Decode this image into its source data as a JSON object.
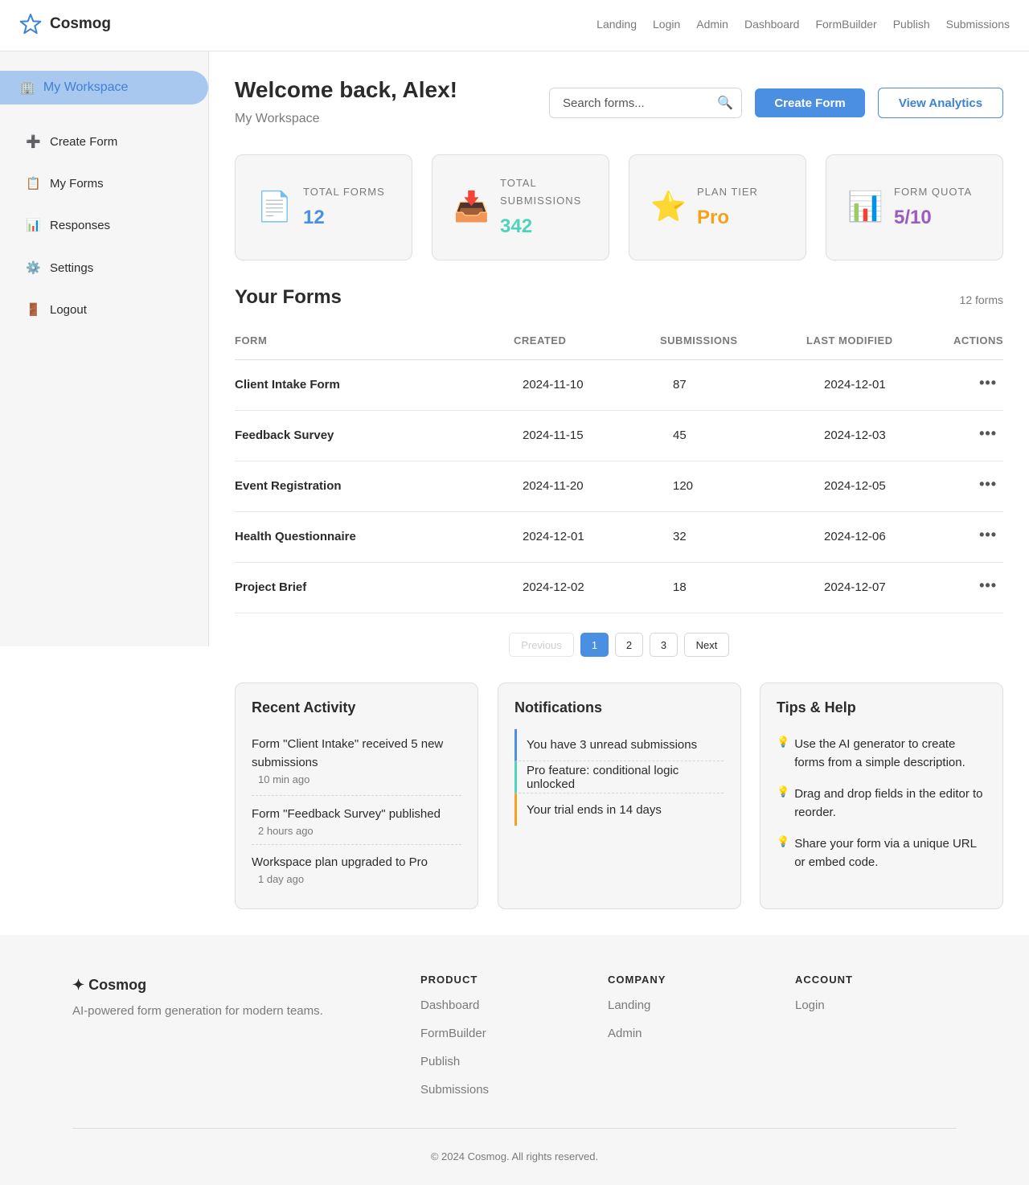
{
  "app": {
    "name": "Cosmog"
  },
  "nav": [
    "Landing",
    "Login",
    "Admin",
    "Dashboard",
    "FormBuilder",
    "Publish",
    "Submissions"
  ],
  "sidebar": {
    "workspace": {
      "icon": "🏢",
      "label": "My Workspace"
    },
    "items": [
      {
        "icon": "➕",
        "label": "Create Form"
      },
      {
        "icon": "📋",
        "label": "My Forms"
      },
      {
        "icon": "📊",
        "label": "Responses"
      },
      {
        "icon": "⚙️",
        "label": "Settings"
      },
      {
        "icon": "🚪",
        "label": "Logout"
      }
    ]
  },
  "header": {
    "title": "Welcome back, Alex!",
    "subtitle": "My Workspace",
    "search_placeholder": "Search forms...",
    "create_label": "Create Form",
    "analytics_label": "View Analytics"
  },
  "stats": [
    {
      "icon": "📄",
      "label": "Total Forms",
      "value": "12",
      "color": "#4a8fe2"
    },
    {
      "icon": "📥",
      "label": "Total Submissions",
      "value": "342",
      "color": "#4fd3bd"
    },
    {
      "icon": "⭐",
      "label": "Plan Tier",
      "value": "Pro",
      "color": "#f4a11c"
    },
    {
      "icon": "📊",
      "label": "Form Quota",
      "value": "5/10",
      "color": "#9b5bc0"
    }
  ],
  "forms": {
    "title": "Your Forms",
    "count": "12 forms",
    "columns": [
      "FORM",
      "CREATED",
      "SUBMISSIONS",
      "LAST MODIFIED",
      "ACTIONS"
    ],
    "rows": [
      {
        "name": "Client Intake Form",
        "created": "2024-11-10",
        "submissions": "87",
        "modified": "2024-12-01"
      },
      {
        "name": "Feedback Survey",
        "created": "2024-11-15",
        "submissions": "45",
        "modified": "2024-12-03"
      },
      {
        "name": "Event Registration",
        "created": "2024-11-20",
        "submissions": "120",
        "modified": "2024-12-05"
      },
      {
        "name": "Health Questionnaire",
        "created": "2024-12-01",
        "submissions": "32",
        "modified": "2024-12-06"
      },
      {
        "name": "Project Brief",
        "created": "2024-12-02",
        "submissions": "18",
        "modified": "2024-12-07"
      }
    ],
    "actions_glyph": "•••"
  },
  "pagination": {
    "previous": "Previous",
    "pages": [
      "1",
      "2",
      "3"
    ],
    "next": "Next",
    "current": "1"
  },
  "activity": {
    "title": "Recent Activity",
    "items": [
      {
        "text": "Form \"Client Intake\" received 5 new submissions",
        "time": "10 min ago"
      },
      {
        "text": "Form \"Feedback Survey\" published",
        "time": "2 hours ago"
      },
      {
        "text": "Workspace plan upgraded to Pro",
        "time": "1 day ago"
      }
    ]
  },
  "notifications": {
    "title": "Notifications",
    "items": [
      {
        "text": "You have 3 unread submissions",
        "color": "#4a8fe2"
      },
      {
        "text": "Pro feature: conditional logic unlocked",
        "color": "#4fd3bd"
      },
      {
        "text": "Your trial ends in 14 days",
        "color": "#f4a11c"
      }
    ]
  },
  "tips": {
    "title": "Tips & Help",
    "icon": "💡",
    "items": [
      "Use the AI generator to create forms from a simple description.",
      "Drag and drop fields in the editor to reorder.",
      "Share your form via a unique URL or embed code."
    ]
  },
  "footer": {
    "brand": "✦ Cosmog",
    "tagline": "AI-powered form generation for modern teams.",
    "columns": [
      {
        "heading": "PRODUCT",
        "links": [
          "Dashboard",
          "FormBuilder",
          "Publish",
          "Submissions"
        ]
      },
      {
        "heading": "COMPANY",
        "links": [
          "Landing",
          "Admin"
        ]
      },
      {
        "heading": "ACCOUNT",
        "links": [
          "Login"
        ]
      }
    ],
    "copyright": "© 2024 Cosmog. All rights reserved."
  }
}
